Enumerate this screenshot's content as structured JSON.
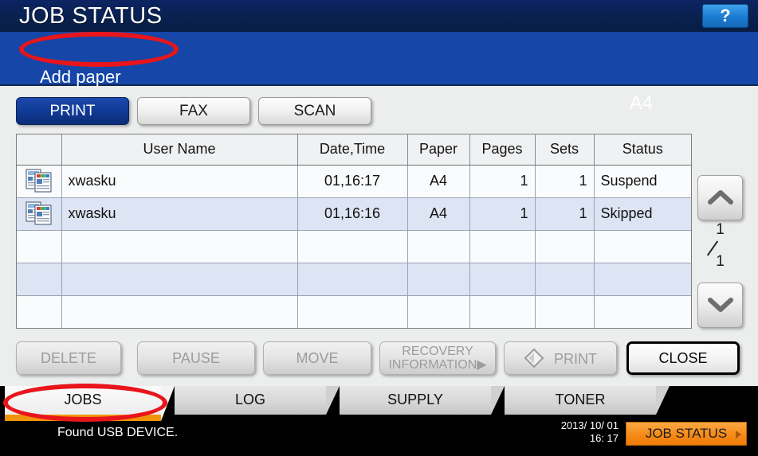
{
  "header": {
    "title": "JOB STATUS",
    "help_label": "?",
    "help_icon": "question-mark-icon"
  },
  "alert": {
    "message": "Add paper",
    "paper_size": "A4"
  },
  "job_type_tabs": [
    {
      "label": "PRINT",
      "active": true
    },
    {
      "label": "FAX",
      "active": false
    },
    {
      "label": "SCAN",
      "active": false
    }
  ],
  "table": {
    "columns": [
      "",
      "User Name",
      "Date,Time",
      "Paper",
      "Pages",
      "Sets",
      "Status"
    ],
    "rows": [
      {
        "icon": "print-job-icon",
        "user": "xwasku",
        "date": "01,16:17",
        "paper": "A4",
        "pages": "1",
        "sets": "1",
        "status": "Suspend"
      },
      {
        "icon": "print-job-icon",
        "user": "xwasku",
        "date": "01,16:16",
        "paper": "A4",
        "pages": "1",
        "sets": "1",
        "status": "Skipped"
      },
      {
        "icon": "",
        "user": "",
        "date": "",
        "paper": "",
        "pages": "",
        "sets": "",
        "status": ""
      },
      {
        "icon": "",
        "user": "",
        "date": "",
        "paper": "",
        "pages": "",
        "sets": "",
        "status": ""
      },
      {
        "icon": "",
        "user": "",
        "date": "",
        "paper": "",
        "pages": "",
        "sets": "",
        "status": ""
      }
    ]
  },
  "pager": {
    "current_page": "1",
    "total_pages": "1",
    "up_icon": "chevron-up-icon",
    "down_icon": "chevron-down-icon"
  },
  "action_buttons": [
    {
      "label": "DELETE",
      "enabled": false
    },
    {
      "label": "PAUSE",
      "enabled": false
    },
    {
      "label": "MOVE",
      "enabled": false
    },
    {
      "label": "RECOVERY",
      "label2": "INFORMATION▶",
      "enabled": false
    },
    {
      "label": "PRINT",
      "enabled": false,
      "icon": "diamond-print-icon"
    },
    {
      "label": "CLOSE",
      "enabled": true
    }
  ],
  "bottom_tabs": [
    {
      "label": "JOBS",
      "active": true
    },
    {
      "label": "LOG",
      "active": false
    },
    {
      "label": "SUPPLY",
      "active": false
    },
    {
      "label": "TONER",
      "active": false
    }
  ],
  "status_bar": {
    "message": "Found USB DEVICE.",
    "date": "2013/ 10/ 01",
    "time": "16: 17",
    "job_status_label": "JOB STATUS"
  },
  "colors": {
    "title_bar": "#09214f",
    "alert_band": "#1546a8",
    "active_tab": "#103a95",
    "accent_orange": "#f0940c",
    "job_status_orange": "#f58a18",
    "annotation_red": "#e8161b",
    "row_alt": "#dde4f3"
  }
}
